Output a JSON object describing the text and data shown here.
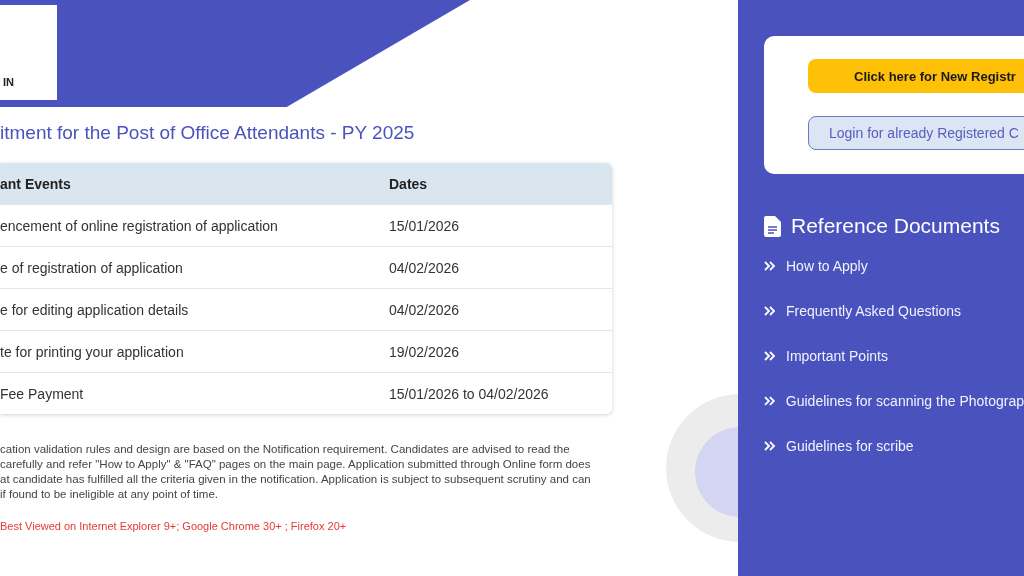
{
  "logo": {
    "text": "IN"
  },
  "title": "itment for the Post of Office Attendants - PY 2025",
  "table": {
    "columns": [
      "ant Events",
      "Dates"
    ],
    "rows": [
      [
        "encement of online registration of application",
        "15/01/2026"
      ],
      [
        "e of registration of application",
        "04/02/2026"
      ],
      [
        "e for editing application details",
        "04/02/2026"
      ],
      [
        "te for printing your application",
        "19/02/2026"
      ],
      [
        "Fee Payment",
        "15/01/2026 to 04/02/2026"
      ]
    ]
  },
  "notice_lines": [
    "cation validation rules and design are based on the Notification requirement. Candidates are advised to read the",
    "carefully and refer \"How to Apply\" & \"FAQ\" pages on the main page. Application submitted through Online form does",
    "at candidate has fulfilled all the criteria given in the notification. Application is subject to subsequent scrutiny and can",
    "if found to be ineligible at any point of time."
  ],
  "browser_note": "Best Viewed on Internet Explorer 9+; Google Chrome 30+ ; Firefox 20+",
  "actions": [
    {
      "label": "Click here for New Registr",
      "kind": "primary"
    },
    {
      "label": "Login for already Registered C",
      "kind": "secondary"
    }
  ],
  "reference": {
    "heading": "Reference Documents",
    "items": [
      "How to Apply",
      "Frequently Asked Questions",
      "Important Points",
      "Guidelines for scanning the Photograp",
      "Guidelines for scribe"
    ]
  }
}
